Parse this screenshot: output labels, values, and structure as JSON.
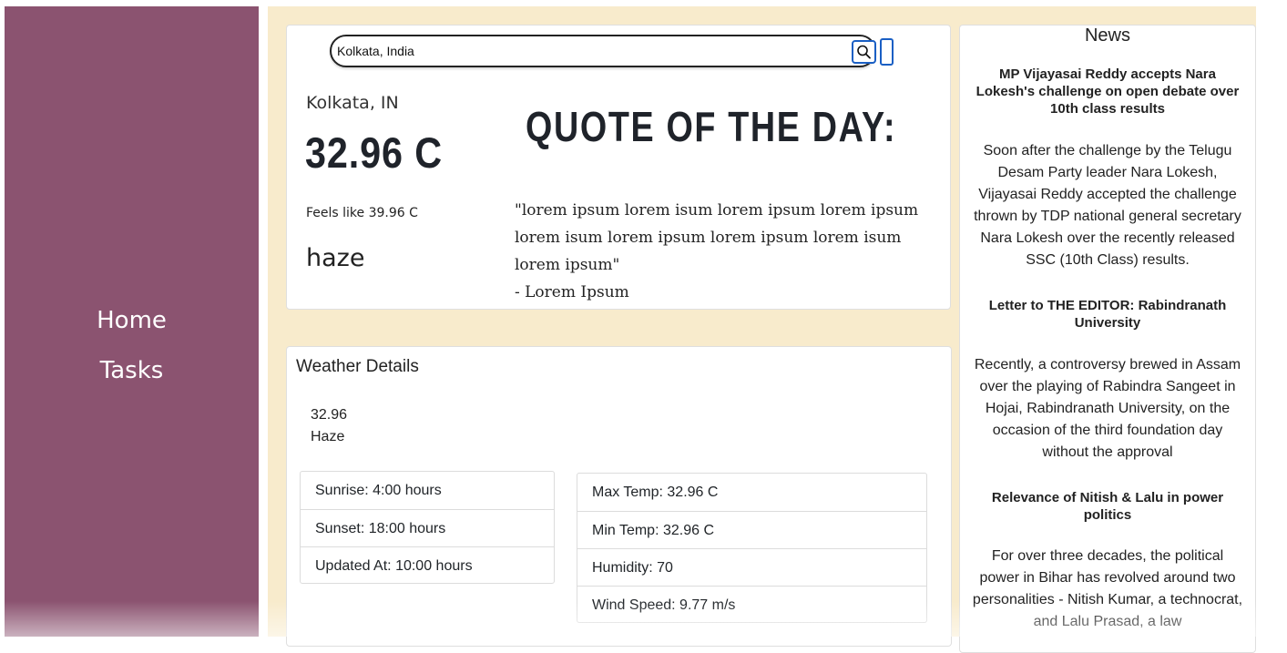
{
  "sidebar": {
    "items": [
      {
        "label": "Home"
      },
      {
        "label": "Tasks"
      }
    ]
  },
  "search": {
    "value": "Kolkata, India",
    "icon": "search-icon"
  },
  "weather": {
    "city": "Kolkata, IN",
    "temperature": "32.96 C",
    "feels_like": "Feels like 39.96 C",
    "condition": "haze"
  },
  "quote": {
    "title": "QUOTE OF THE DAY:",
    "text": "\"lorem ipsum lorem isum lorem ipsum lorem ipsum lorem isum lorem ipsum lorem ipsum lorem isum lorem ipsum\"",
    "author": "- Lorem Ipsum"
  },
  "details": {
    "title": "Weather Details",
    "temp": "32.96",
    "condition": "Haze",
    "left_list": [
      "Sunrise: 4:00 hours",
      "Sunset: 18:00 hours",
      "Updated At: 10:00 hours"
    ],
    "right_list": [
      "Max Temp: 32.96 C",
      "Min Temp: 32.96 C",
      "Humidity: 70",
      "Wind Speed: 9.77 m/s"
    ]
  },
  "news": {
    "heading": "News",
    "articles": [
      {
        "title": "MP Vijayasai Reddy accepts Nara Lokesh's challenge on open debate over 10th class results",
        "body": "Soon after the challenge by the Telugu Desam Party leader Nara Lokesh, Vijayasai Reddy accepted the challenge thrown by TDP national general secretary Nara Lokesh over the recently released SSC (10th Class) results."
      },
      {
        "title": "Letter to THE EDITOR: Rabindranath University",
        "body": "Recently, a controversy brewed in Assam over the playing of Rabindra Sangeet in Hojai, Rabindranath University, on the occasion of the third foundation day without the approval"
      },
      {
        "title": "Relevance of Nitish & Lalu in power politics",
        "body": "For over three decades, the political power in Bihar has revolved around two personalities - Nitish Kumar, a technocrat, and Lalu Prasad, a law"
      }
    ]
  }
}
